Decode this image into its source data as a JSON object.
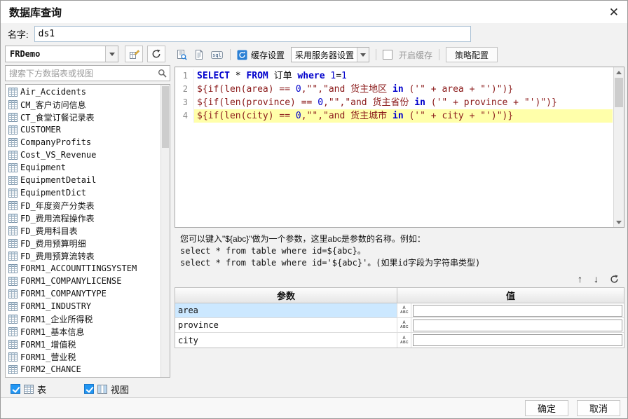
{
  "dialog": {
    "title": "数据库查询",
    "ok_label": "确定",
    "cancel_label": "取消"
  },
  "icons": {
    "close": "✕",
    "move_up": "↑",
    "move_down": "↓",
    "sql_badge": "sql",
    "param_type_top": "A",
    "param_type_bottom": "ABC"
  },
  "name_row": {
    "label": "名字:",
    "value": "ds1"
  },
  "left_panel": {
    "connection_selected": "FRDemo",
    "search_placeholder": "搜索下方数据表或视图",
    "tables": [
      "Air_Accidents",
      "CM_客户访问信息",
      "CT_食堂订餐记录表",
      "CUSTOMER",
      "CompanyProfits",
      "Cost_VS_Revenue",
      "Equipment",
      "EquipmentDetail",
      "EquipmentDict",
      "FD_年度资产分类表",
      "FD_费用流程操作表",
      "FD_费用科目表",
      "FD_费用预算明细",
      "FD_费用预算流转表",
      "FORM1_ACCOUNTTINGSYSTEM",
      "FORM1_COMPANYLICENSE",
      "FORM1_COMPANYTYPE",
      "FORM1_INDUSTRY",
      "FORM1_企业所得税",
      "FORM1_基本信息",
      "FORM1_增值税",
      "FORM1_营业税",
      "FORM2_CHANCE"
    ],
    "table_filter_label": "表",
    "view_filter_label": "视图"
  },
  "toolbar": {
    "cache_settings_label": "缓存设置",
    "cache_mode_value": "采用服务器设置",
    "enable_cache_label": "开启缓存",
    "policy_config_label": "策略配置"
  },
  "sql_editor": {
    "lines": [
      {
        "num": "1",
        "highlight": false,
        "tokens": [
          [
            "kw",
            "SELECT"
          ],
          [
            "pl",
            " * "
          ],
          [
            "kw",
            "FROM"
          ],
          [
            "pl",
            " 订单 "
          ],
          [
            "kw",
            "where"
          ],
          [
            "pl",
            " "
          ],
          [
            "nm",
            "1"
          ],
          [
            "pl",
            "="
          ],
          [
            "nm",
            "1"
          ]
        ]
      },
      {
        "num": "2",
        "highlight": false,
        "tokens": [
          [
            "fm",
            "${if(len(area) == "
          ],
          [
            "nm",
            "0"
          ],
          [
            "fm",
            ",\"\",\"and 货主地区 "
          ],
          [
            "kw",
            "in"
          ],
          [
            "fm",
            " ('\" + area + \"')\")}"
          ]
        ]
      },
      {
        "num": "3",
        "highlight": false,
        "tokens": [
          [
            "fm",
            "${if(len(province) == "
          ],
          [
            "nm",
            "0"
          ],
          [
            "fm",
            ",\"\",\"and 货主省份 "
          ],
          [
            "kw",
            "in"
          ],
          [
            "fm",
            " ('\" + province + \"')\")}"
          ]
        ]
      },
      {
        "num": "4",
        "highlight": true,
        "tokens": [
          [
            "fm",
            "${if(len(city) == "
          ],
          [
            "nm",
            "0"
          ],
          [
            "fm",
            ",\"\",\"and 货主城市 "
          ],
          [
            "kw",
            "in"
          ],
          [
            "fm",
            " ('\" + city + \"')\")}"
          ]
        ]
      }
    ]
  },
  "help": {
    "line1": "您可以键入\"${abc}\"做为一个参数，这里abc是参数的名称。例如：",
    "line2": "select * from table where id=${abc}。",
    "line3": "select * from table where id='${abc}'。(如果id字段为字符串类型)"
  },
  "params": {
    "col_param": "参数",
    "col_value": "值",
    "rows": [
      {
        "name": "area",
        "value": "",
        "selected": true
      },
      {
        "name": "province",
        "value": "",
        "selected": false
      },
      {
        "name": "city",
        "value": "",
        "selected": false
      }
    ]
  }
}
